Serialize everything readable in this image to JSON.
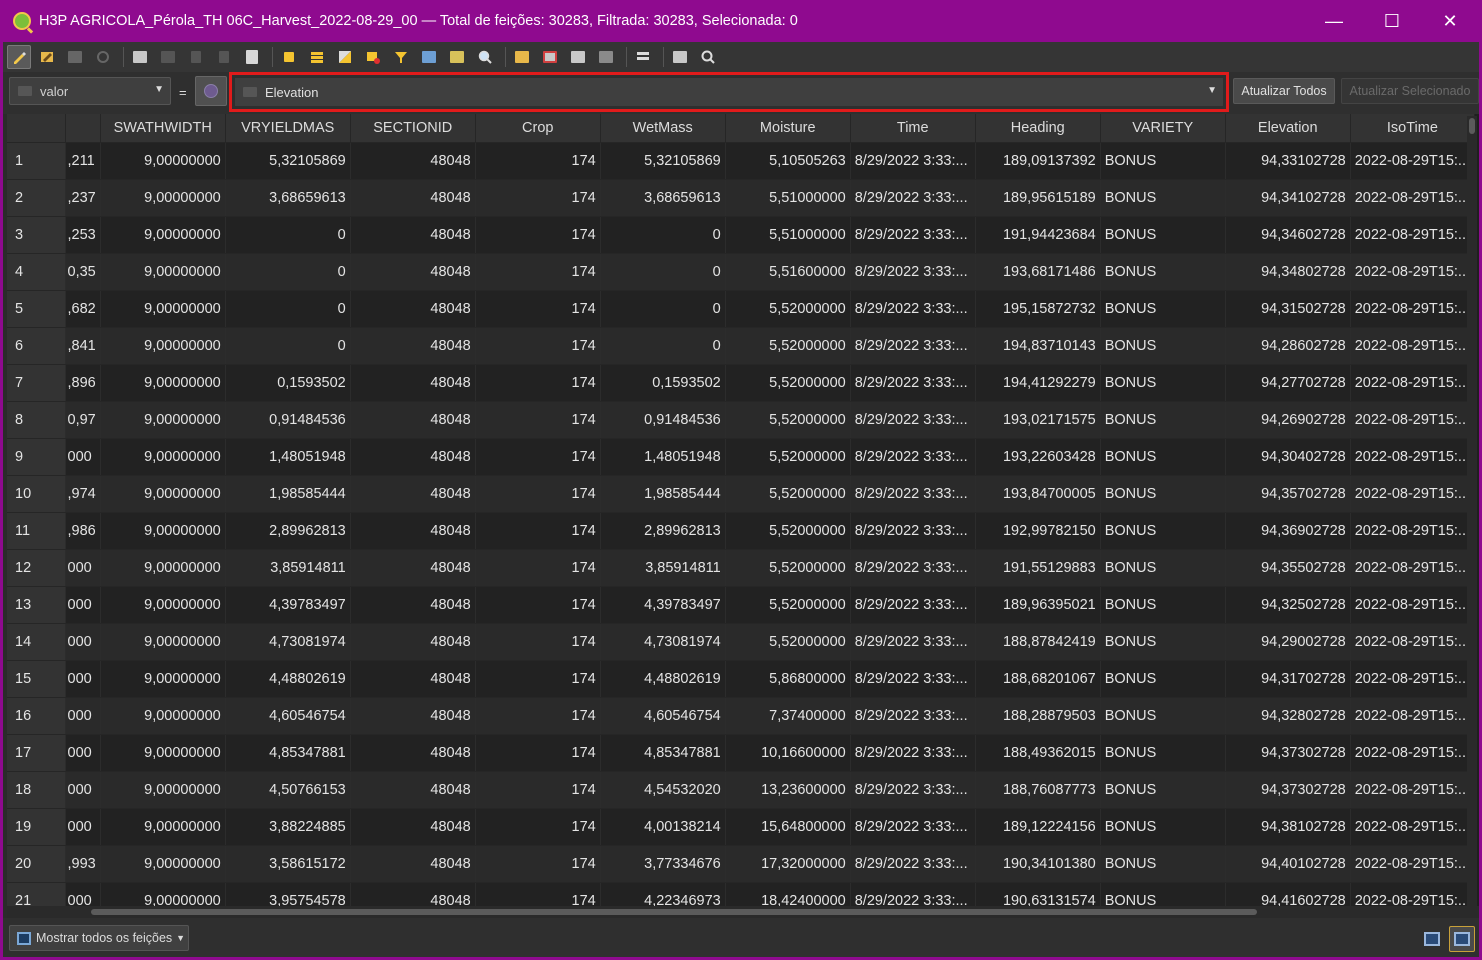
{
  "window": {
    "title": "H3P AGRICOLA_Pérola_TH 06C_Harvest_2022-08-29_00 — Total de feições: 30283, Filtrada: 30283, Selecionada: 0",
    "controls": {
      "minimize": "—",
      "maximize": "☐",
      "close": "✕"
    }
  },
  "toolbar": {
    "icons": [
      "edit-pencil-icon",
      "multi-edit-icon",
      "save-edits-icon",
      "reload-icon",
      "add-feature-icon",
      "delete-feature-icon",
      "cut-icon",
      "copy-icon",
      "paste-icon",
      "select-by-expression-icon",
      "select-all-icon",
      "invert-selection-icon",
      "deselect-all-icon",
      "filter-select-icon",
      "move-to-top-icon",
      "pan-to-selection-icon",
      "zoom-to-selection-icon",
      "new-field-icon",
      "delete-field-icon",
      "field-calculator-icon",
      "conditional-format-icon",
      "actions-icon",
      "dock-icon",
      "zoom-map-icon"
    ]
  },
  "filter": {
    "field_label": "valor",
    "equals": "=",
    "value_field": "Elevation",
    "update_all_label": "Atualizar Todos",
    "update_selected_label": "Atualizar Selecionado"
  },
  "table": {
    "columns": [
      "",
      "SWATHWIDTH",
      "VRYIELDMAS",
      "SECTIONID",
      "Crop",
      "WetMass",
      "Moisture",
      "Time",
      "Heading",
      "VARIETY",
      "Elevation",
      "IsoTime"
    ],
    "rows": [
      [
        "1",
        ",211",
        "9,00000000",
        "5,32105869",
        "48048",
        "174",
        "5,32105869",
        "5,10505263",
        "8/29/2022 3:33:...",
        "189,09137392",
        "BONUS",
        "94,33102728",
        "2022-08-29T15:..."
      ],
      [
        "2",
        ",237",
        "9,00000000",
        "3,68659613",
        "48048",
        "174",
        "3,68659613",
        "5,51000000",
        "8/29/2022 3:33:...",
        "189,95615189",
        "BONUS",
        "94,34102728",
        "2022-08-29T15:..."
      ],
      [
        "3",
        ",253",
        "9,00000000",
        "0",
        "48048",
        "174",
        "0",
        "5,51000000",
        "8/29/2022 3:33:...",
        "191,94423684",
        "BONUS",
        "94,34602728",
        "2022-08-29T15:..."
      ],
      [
        "4",
        "0,35",
        "9,00000000",
        "0",
        "48048",
        "174",
        "0",
        "5,51600000",
        "8/29/2022 3:33:...",
        "193,68171486",
        "BONUS",
        "94,34802728",
        "2022-08-29T15:..."
      ],
      [
        "5",
        ",682",
        "9,00000000",
        "0",
        "48048",
        "174",
        "0",
        "5,52000000",
        "8/29/2022 3:33:...",
        "195,15872732",
        "BONUS",
        "94,31502728",
        "2022-08-29T15:..."
      ],
      [
        "6",
        ",841",
        "9,00000000",
        "0",
        "48048",
        "174",
        "0",
        "5,52000000",
        "8/29/2022 3:33:...",
        "194,83710143",
        "BONUS",
        "94,28602728",
        "2022-08-29T15:..."
      ],
      [
        "7",
        ",896",
        "9,00000000",
        "0,1593502",
        "48048",
        "174",
        "0,1593502",
        "5,52000000",
        "8/29/2022 3:33:...",
        "194,41292279",
        "BONUS",
        "94,27702728",
        "2022-08-29T15:..."
      ],
      [
        "8",
        "0,97",
        "9,00000000",
        "0,91484536",
        "48048",
        "174",
        "0,91484536",
        "5,52000000",
        "8/29/2022 3:33:...",
        "193,02171575",
        "BONUS",
        "94,26902728",
        "2022-08-29T15:..."
      ],
      [
        "9",
        "000",
        "9,00000000",
        "1,48051948",
        "48048",
        "174",
        "1,48051948",
        "5,52000000",
        "8/29/2022 3:33:...",
        "193,22603428",
        "BONUS",
        "94,30402728",
        "2022-08-29T15:..."
      ],
      [
        "10",
        ",974",
        "9,00000000",
        "1,98585444",
        "48048",
        "174",
        "1,98585444",
        "5,52000000",
        "8/29/2022 3:33:...",
        "193,84700005",
        "BONUS",
        "94,35702728",
        "2022-08-29T15:..."
      ],
      [
        "11",
        ",986",
        "9,00000000",
        "2,89962813",
        "48048",
        "174",
        "2,89962813",
        "5,52000000",
        "8/29/2022 3:33:...",
        "192,99782150",
        "BONUS",
        "94,36902728",
        "2022-08-29T15:..."
      ],
      [
        "12",
        "000",
        "9,00000000",
        "3,85914811",
        "48048",
        "174",
        "3,85914811",
        "5,52000000",
        "8/29/2022 3:33:...",
        "191,55129883",
        "BONUS",
        "94,35502728",
        "2022-08-29T15:..."
      ],
      [
        "13",
        "000",
        "9,00000000",
        "4,39783497",
        "48048",
        "174",
        "4,39783497",
        "5,52000000",
        "8/29/2022 3:33:...",
        "189,96395021",
        "BONUS",
        "94,32502728",
        "2022-08-29T15:..."
      ],
      [
        "14",
        "000",
        "9,00000000",
        "4,73081974",
        "48048",
        "174",
        "4,73081974",
        "5,52000000",
        "8/29/2022 3:33:...",
        "188,87842419",
        "BONUS",
        "94,29002728",
        "2022-08-29T15:..."
      ],
      [
        "15",
        "000",
        "9,00000000",
        "4,48802619",
        "48048",
        "174",
        "4,48802619",
        "5,86800000",
        "8/29/2022 3:33:...",
        "188,68201067",
        "BONUS",
        "94,31702728",
        "2022-08-29T15:..."
      ],
      [
        "16",
        "000",
        "9,00000000",
        "4,60546754",
        "48048",
        "174",
        "4,60546754",
        "7,37400000",
        "8/29/2022 3:33:...",
        "188,28879503",
        "BONUS",
        "94,32802728",
        "2022-08-29T15:..."
      ],
      [
        "17",
        "000",
        "9,00000000",
        "4,85347881",
        "48048",
        "174",
        "4,85347881",
        "10,16600000",
        "8/29/2022 3:33:...",
        "188,49362015",
        "BONUS",
        "94,37302728",
        "2022-08-29T15:..."
      ],
      [
        "18",
        "000",
        "9,00000000",
        "4,50766153",
        "48048",
        "174",
        "4,54532020",
        "13,23600000",
        "8/29/2022 3:33:...",
        "188,76087773",
        "BONUS",
        "94,37302728",
        "2022-08-29T15:..."
      ],
      [
        "19",
        "000",
        "9,00000000",
        "3,88224885",
        "48048",
        "174",
        "4,00138214",
        "15,64800000",
        "8/29/2022 3:33:...",
        "189,12224156",
        "BONUS",
        "94,38102728",
        "2022-08-29T15:..."
      ],
      [
        "20",
        ",993",
        "9,00000000",
        "3,58615172",
        "48048",
        "174",
        "3,77334676",
        "17,32000000",
        "8/29/2022 3:33:...",
        "190,34101380",
        "BONUS",
        "94,40102728",
        "2022-08-29T15:..."
      ],
      [
        "21",
        "000",
        "9,00000000",
        "3,95754578",
        "48048",
        "174",
        "4,22346973",
        "18,42400000",
        "8/29/2022 3:33:...",
        "190,63131574",
        "BONUS",
        "94,41602728",
        "2022-08-29T15:..."
      ]
    ]
  },
  "statusbar": {
    "show_all_label": "Mostrar todos os feições",
    "view_icons": [
      "form-view-icon",
      "table-view-icon"
    ]
  },
  "colors": {
    "titlebar": "#8f0a8f",
    "highlight_border": "#e11b1b",
    "background": "#2b2b2b"
  }
}
